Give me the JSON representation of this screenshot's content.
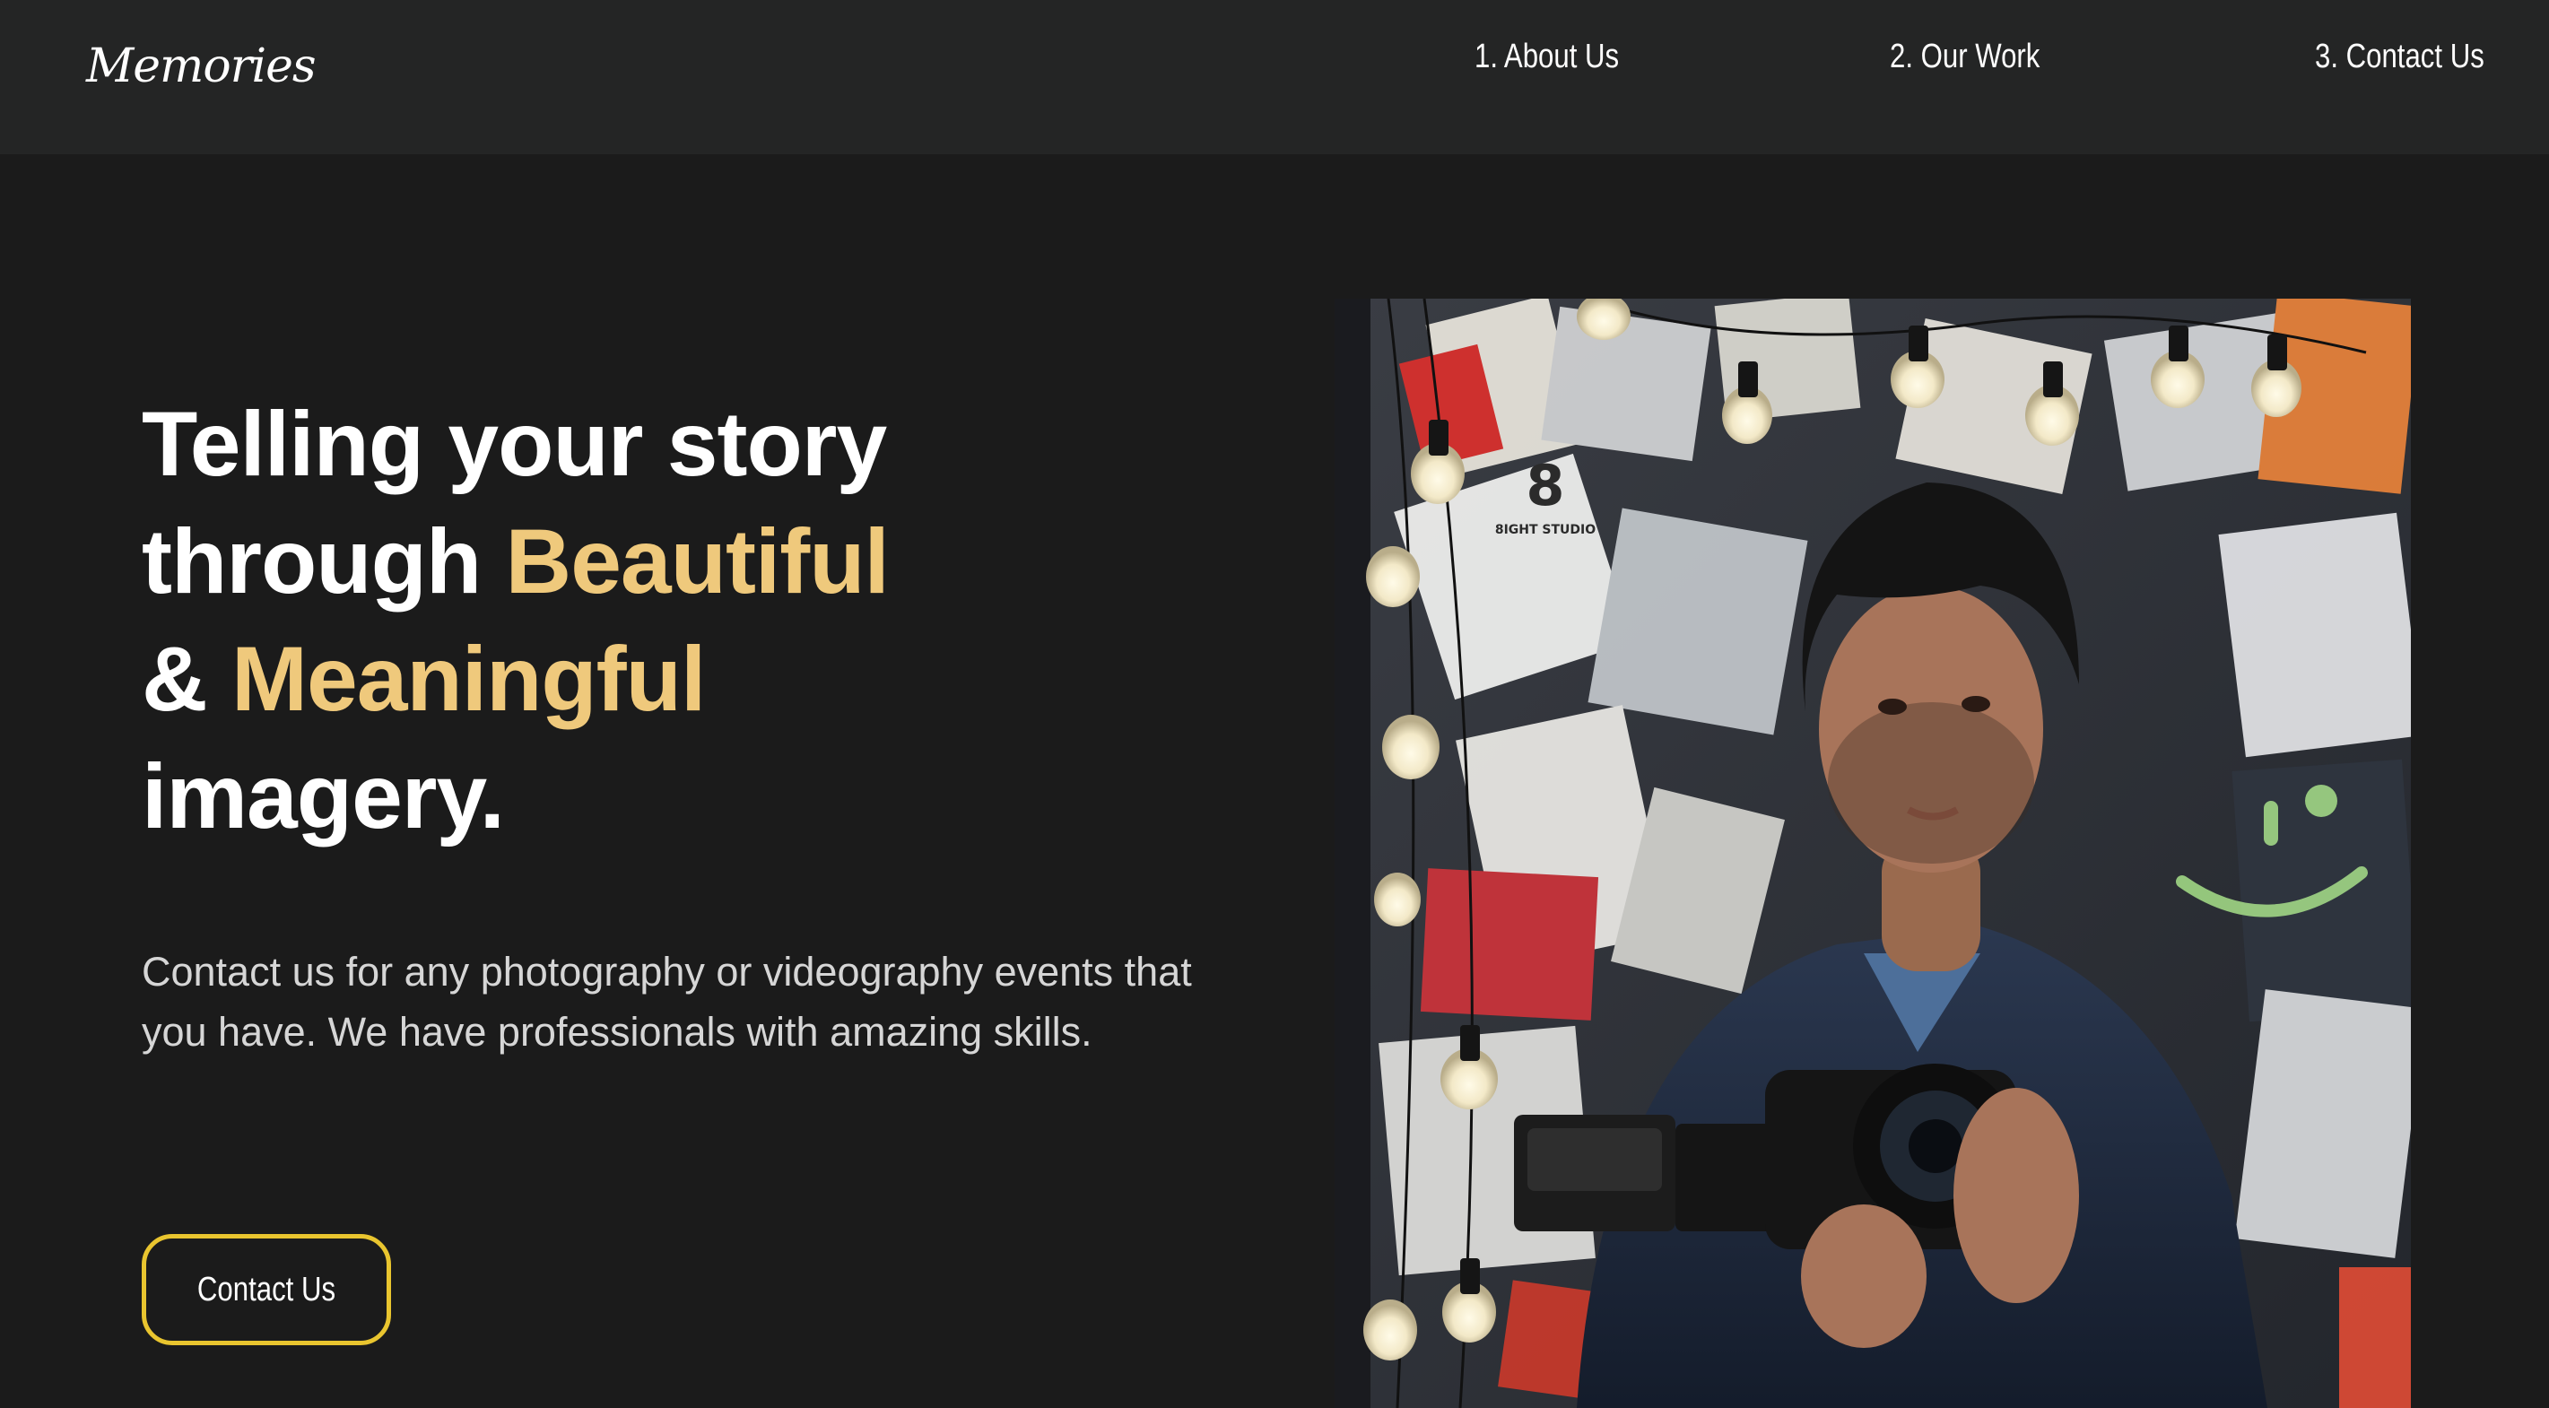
{
  "brand": {
    "logo_text": "Memories"
  },
  "nav": {
    "items": [
      {
        "label": "1. About Us"
      },
      {
        "label": "2. Our Work"
      },
      {
        "label": "3. Contact Us"
      }
    ]
  },
  "hero": {
    "title_line1": "Telling your story",
    "title_line2_plain": "through ",
    "title_line2_accent": "Beautiful",
    "title_line3_plain": "& ",
    "title_line3_accent": "Meaningful",
    "title_line4": "imagery.",
    "description": "Contact us for any photography or videography events that you have. We have professionals with amazing skills.",
    "cta_label": "Contact Us"
  },
  "photo": {
    "studio_mark": "8",
    "studio_name": "8IGHT STUDIO"
  },
  "colors": {
    "background": "#1b1b1b",
    "navbar": "#242525",
    "accent_text": "#efc97c",
    "button_border": "#e9c52f"
  }
}
